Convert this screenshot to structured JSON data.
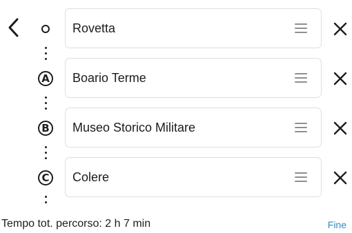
{
  "header": {
    "back_icon": "chevron-left-icon"
  },
  "stops": [
    {
      "marker": "",
      "marker_type": "origin",
      "name": "Rovetta"
    },
    {
      "marker": "A",
      "marker_type": "letter",
      "name": "Boario Terme"
    },
    {
      "marker": "B",
      "marker_type": "letter",
      "name": "Museo Storico Militare"
    },
    {
      "marker": "C",
      "marker_type": "letter",
      "name": "Colere"
    }
  ],
  "icons": {
    "drag": "drag-handle-icon",
    "remove": "close-icon"
  },
  "footer": {
    "total_time": "Tempo tot. percorso: 2 h 7 min",
    "done_label": "Fine",
    "done_color": "#2a8fbd"
  }
}
